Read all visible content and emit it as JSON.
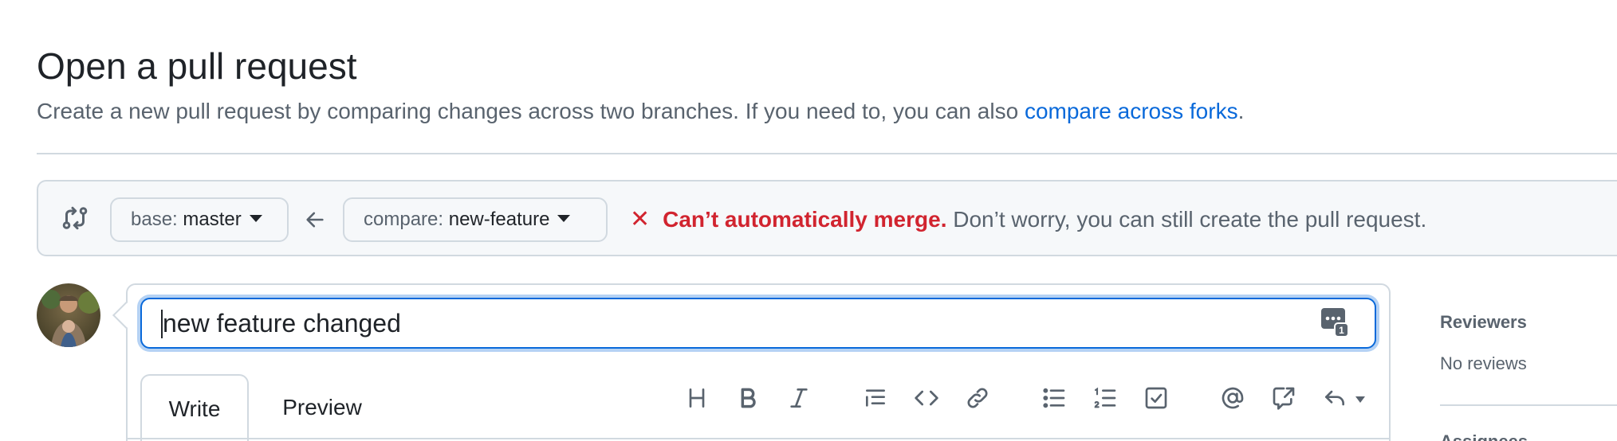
{
  "header": {
    "title": "Open a pull request",
    "subtitle_text": "Create a new pull request by comparing changes across two branches. If you need to, you can also ",
    "subtitle_link": "compare across forks",
    "subtitle_end": "."
  },
  "range": {
    "base_prefix": "base: ",
    "base_branch": "master",
    "compare_prefix": "compare: ",
    "compare_branch": "new-feature",
    "merge_symbol": "✕",
    "merge_status": "Can’t automatically merge.",
    "merge_note": " Don’t worry, you can still create the pull request."
  },
  "editor": {
    "title_value": "new feature changed",
    "tabs": [
      {
        "label": "Write"
      },
      {
        "label": "Preview"
      }
    ],
    "toolbar": [
      "heading-icon",
      "bold-icon",
      "italic-icon",
      "quote-icon",
      "code-icon",
      "link-icon",
      "unordered-list-icon",
      "ordered-list-icon",
      "task-list-icon",
      "mention-icon",
      "cross-reference-icon",
      "reply-icon"
    ],
    "saved_replies_badge": "1"
  },
  "sidebar": {
    "reviewers_heading": "Reviewers",
    "reviewers_value": "No reviews",
    "next_heading": "Assignees"
  },
  "colors": {
    "accent": "#0969da",
    "danger": "#d1242f",
    "muted": "#59636e",
    "border": "#d1d9e0",
    "subtle_bg": "#f6f8fa"
  }
}
